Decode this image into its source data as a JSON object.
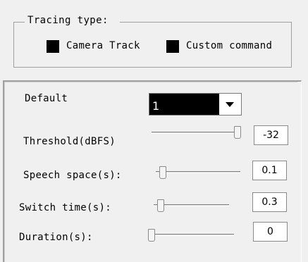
{
  "tracing_type": {
    "title": "Tracing type:",
    "options": [
      {
        "label": "Camera Track"
      },
      {
        "label": "Custom command"
      }
    ]
  },
  "settings": {
    "default_label": "Default",
    "default_value": "1",
    "rows": [
      {
        "label": "Threshold(dBFS)",
        "value": "-32",
        "slider_fraction": 1.0
      },
      {
        "label": "Speech space(s):",
        "value": "0.1",
        "slider_fraction": 0.0
      },
      {
        "label": "Switch time(s):",
        "value": "0.3",
        "slider_fraction": 0.0
      },
      {
        "label": "Duration(s):",
        "value": "0",
        "slider_fraction": 0.0
      }
    ]
  }
}
